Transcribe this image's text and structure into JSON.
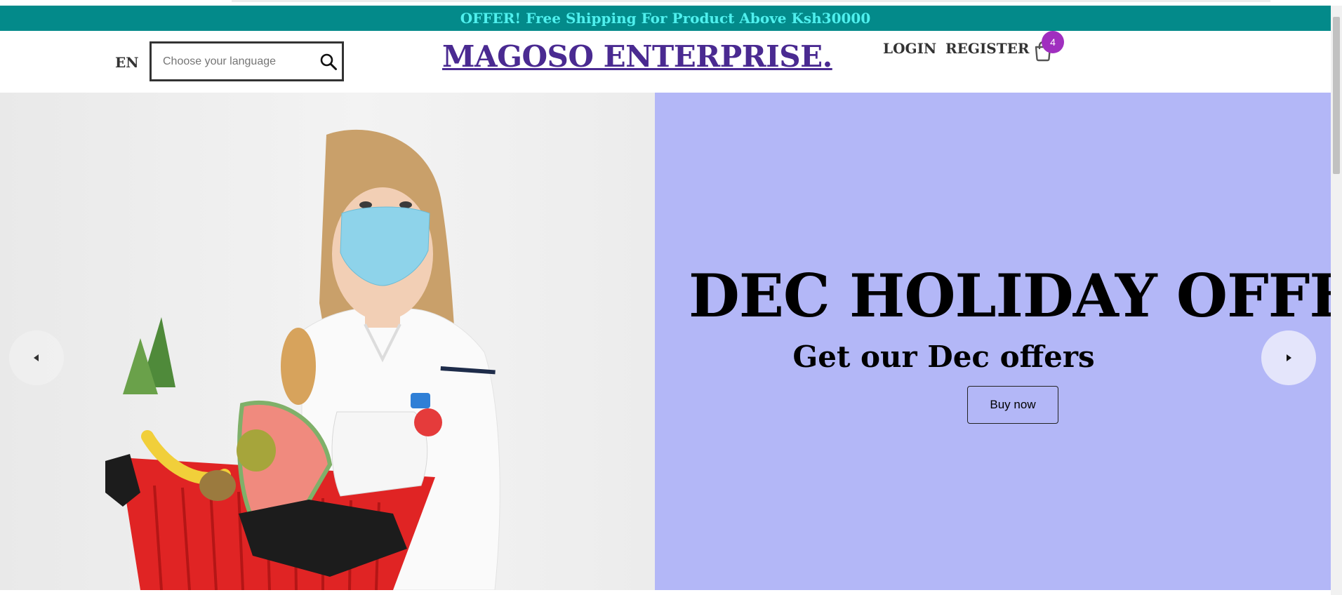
{
  "offer": {
    "text": "OFFER! Free Shipping For Product Above Ksh30000"
  },
  "navbar": {
    "language": "EN",
    "search": {
      "placeholder": "Choose your language"
    },
    "logo": "MAGOSO ENTERPRISE.",
    "login": "LOGIN",
    "register": "REGISTER",
    "cart_count": "4"
  },
  "slider": {
    "title": "DEC HOLIDAY OFFERS",
    "subtitle": "Get our Dec offers",
    "button": "Buy now",
    "background": "#b3b7f7"
  },
  "colors": {
    "offer_bar": "#038a8a",
    "offer_text": "#4ff0ee",
    "logo": "#4a2a91",
    "badge": "#a02fbf"
  },
  "icons": [
    "search-icon",
    "shopping-bag-icon",
    "arrow-left-icon",
    "arrow-right-icon"
  ]
}
